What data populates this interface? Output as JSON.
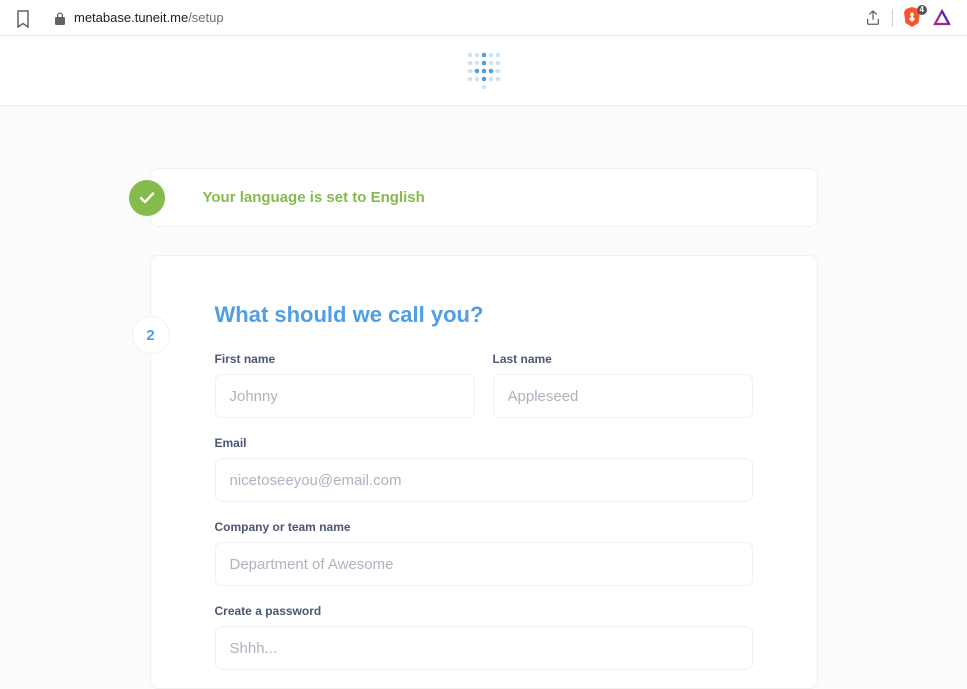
{
  "browser": {
    "url_host": "metabase.tuneit.me",
    "url_path": "/setup",
    "brave_badge": "4"
  },
  "language": {
    "message": "Your language is set to English"
  },
  "setup": {
    "step_number": "2",
    "title": "What should we call you?",
    "fields": {
      "first_name": {
        "label": "First name",
        "placeholder": "Johnny"
      },
      "last_name": {
        "label": "Last name",
        "placeholder": "Appleseed"
      },
      "email": {
        "label": "Email",
        "placeholder": "nicetoseeyou@email.com"
      },
      "company": {
        "label": "Company or team name",
        "placeholder": "Department of Awesome"
      },
      "password": {
        "label": "Create a password",
        "placeholder": "Shhh..."
      }
    }
  }
}
